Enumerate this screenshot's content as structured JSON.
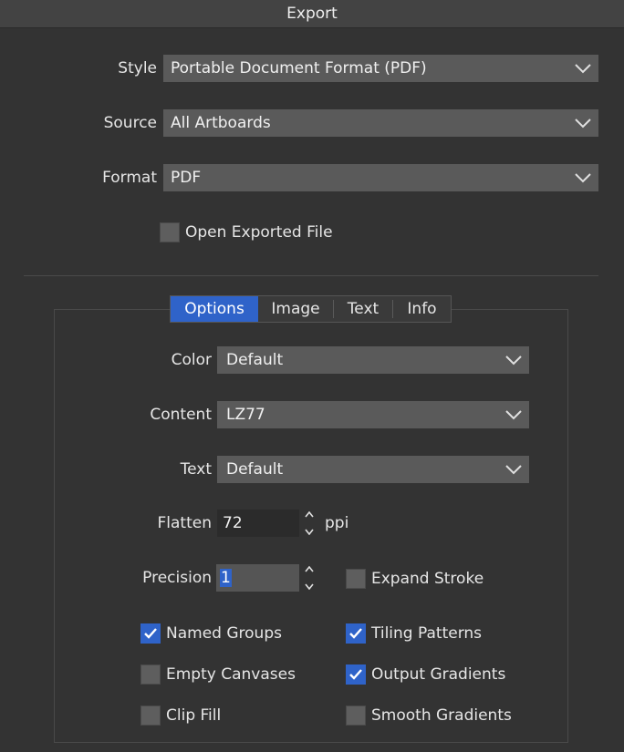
{
  "window": {
    "title": "Export"
  },
  "main": {
    "style": {
      "label": "Style",
      "value": "Portable Document Format (PDF)"
    },
    "source": {
      "label": "Source",
      "value": "All Artboards"
    },
    "format": {
      "label": "Format",
      "value": "PDF"
    },
    "open_exported": {
      "label": "Open Exported File",
      "checked": false
    }
  },
  "tabs": [
    {
      "label": "Options",
      "active": true
    },
    {
      "label": "Image",
      "active": false
    },
    {
      "label": "Text",
      "active": false
    },
    {
      "label": "Info",
      "active": false
    }
  ],
  "options": {
    "color": {
      "label": "Color",
      "value": "Default"
    },
    "content": {
      "label": "Content",
      "value": "LZ77"
    },
    "text": {
      "label": "Text",
      "value": "Default"
    },
    "flatten": {
      "label": "Flatten",
      "value": "72",
      "unit": "ppi"
    },
    "precision": {
      "label": "Precision",
      "value": "1"
    },
    "checkboxes": {
      "expand_stroke": {
        "label": "Expand Stroke",
        "checked": false
      },
      "named_groups": {
        "label": "Named Groups",
        "checked": true
      },
      "tiling_patterns": {
        "label": "Tiling Patterns",
        "checked": true
      },
      "empty_canvases": {
        "label": "Empty Canvases",
        "checked": false
      },
      "output_gradients": {
        "label": "Output Gradients",
        "checked": true
      },
      "clip_fill": {
        "label": "Clip Fill",
        "checked": false
      },
      "smooth_gradients": {
        "label": "Smooth Gradients",
        "checked": false
      }
    }
  },
  "colors": {
    "accent": "#2f63c9",
    "background": "#333333",
    "field": "#5a5a5a"
  }
}
